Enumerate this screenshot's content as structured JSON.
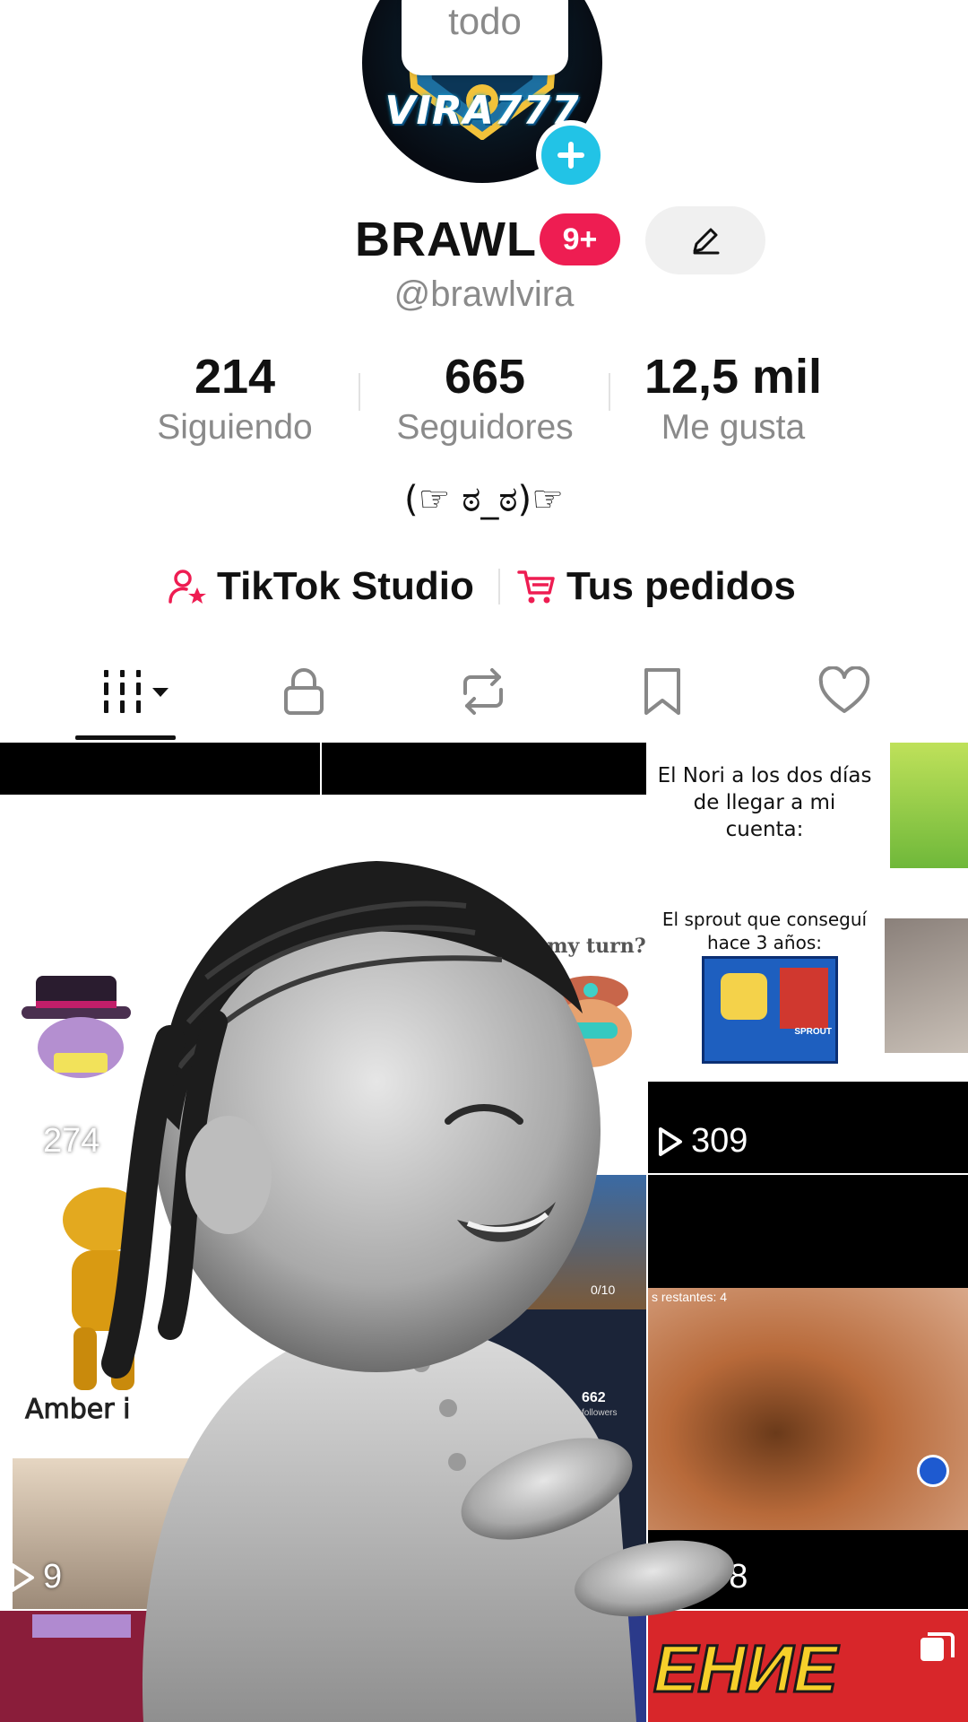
{
  "profile": {
    "note": "todo",
    "avatar_text": "VIRA777",
    "name": "BRAWL",
    "badge": "9+",
    "handle": "@brawlvira",
    "bio": "(☞ ಠ_ಠ)☞"
  },
  "stats": [
    {
      "value": "214",
      "label": "Siguiendo"
    },
    {
      "value": "665",
      "label": "Seguidores"
    },
    {
      "value": "12,5 mil",
      "label": "Me gusta"
    }
  ],
  "links": {
    "studio": "TikTok Studio",
    "orders": "Tus pedidos"
  },
  "tabs": [
    "videos-icon",
    "lock-icon",
    "repost-icon",
    "bookmark-icon",
    "heart-icon"
  ],
  "grid": {
    "views": [
      "274",
      "309",
      "9",
      "298"
    ],
    "captions": {
      "nori": "El Nori a los dos días de llegar a mi cuenta:",
      "sprout": "El sprout que conseguí hace 3 años:",
      "turn": "It's my turn?",
      "amber": "Amber i",
      "game_banner": "ЕНИЕ",
      "stat_small": "662",
      "stat_small_label": "followers",
      "counter": "0/10",
      "restantes": "s restantes: 4",
      "sprout_tag": "SPROUT"
    }
  },
  "colors": {
    "accent": "#ee1d52",
    "cyan": "#22c3e6",
    "muted": "#8a8a8a"
  }
}
